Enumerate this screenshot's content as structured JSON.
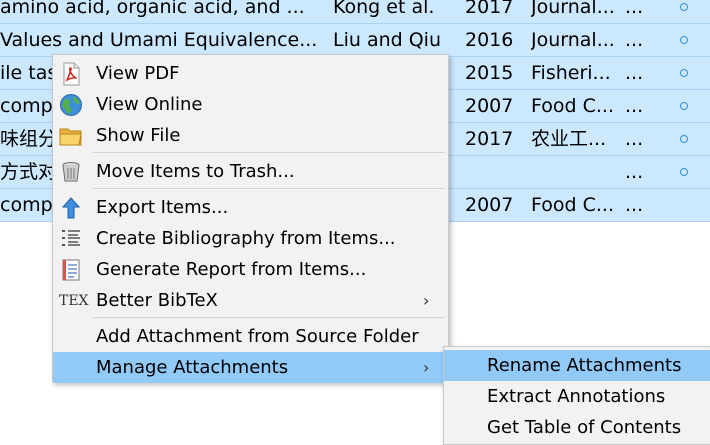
{
  "table": {
    "rows": [
      {
        "title": " amino acid, organic acid, and ...",
        "creator": "Kong et al.",
        "year": "2017",
        "publication": "Journal...",
        "extra": "..."
      },
      {
        "title": "Values and Umami Equivalence...",
        "creator": "Liu and Qiu",
        "year": "2016",
        "publication": "Journal...",
        "extra": "..."
      },
      {
        "title": "ile tas",
        "creator": "",
        "year": "2015",
        "publication": "Fisheri...",
        "extra": "..."
      },
      {
        "title": "comp",
        "creator": "",
        "year": "2007",
        "publication": "Food C...",
        "extra": "..."
      },
      {
        "title": "味组分",
        "creator": "",
        "year": "2017",
        "publication": "农业工...",
        "extra": "..."
      },
      {
        "title": "方式对",
        "creator": "",
        "year": "",
        "publication": "",
        "extra": "..."
      },
      {
        "title": "comp",
        "creator": "",
        "year": "2007",
        "publication": "Food C...",
        "extra": "..."
      }
    ]
  },
  "context_menu": {
    "items": [
      {
        "label": "View PDF",
        "icon": "pdf-icon"
      },
      {
        "label": "View Online",
        "icon": "globe-icon"
      },
      {
        "label": "Show File",
        "icon": "folder-icon"
      },
      {
        "label": "Move Items to Trash...",
        "icon": "trash-icon"
      },
      {
        "label": "Export Items...",
        "icon": "export-arrow-icon"
      },
      {
        "label": "Create Bibliography from Items...",
        "icon": "bibliography-icon"
      },
      {
        "label": "Generate Report from Items...",
        "icon": "report-icon"
      },
      {
        "label": "Better BibTeX",
        "icon": "tex-icon",
        "icon_text": "TEX"
      },
      {
        "label": "Add Attachment from Source Folder",
        "icon": ""
      },
      {
        "label": "Manage Attachments",
        "icon": ""
      }
    ],
    "submenu_arrow": "›"
  },
  "submenu": {
    "items": [
      {
        "label": "Rename Attachments"
      },
      {
        "label": "Extract Annotations"
      },
      {
        "label": "Get Table of Contents"
      }
    ]
  },
  "colors": {
    "row_background": "#cce8ff",
    "menu_background": "#f2f2f2",
    "highlight": "#91c9f7",
    "attachment_dot": "#2f8fd8"
  }
}
